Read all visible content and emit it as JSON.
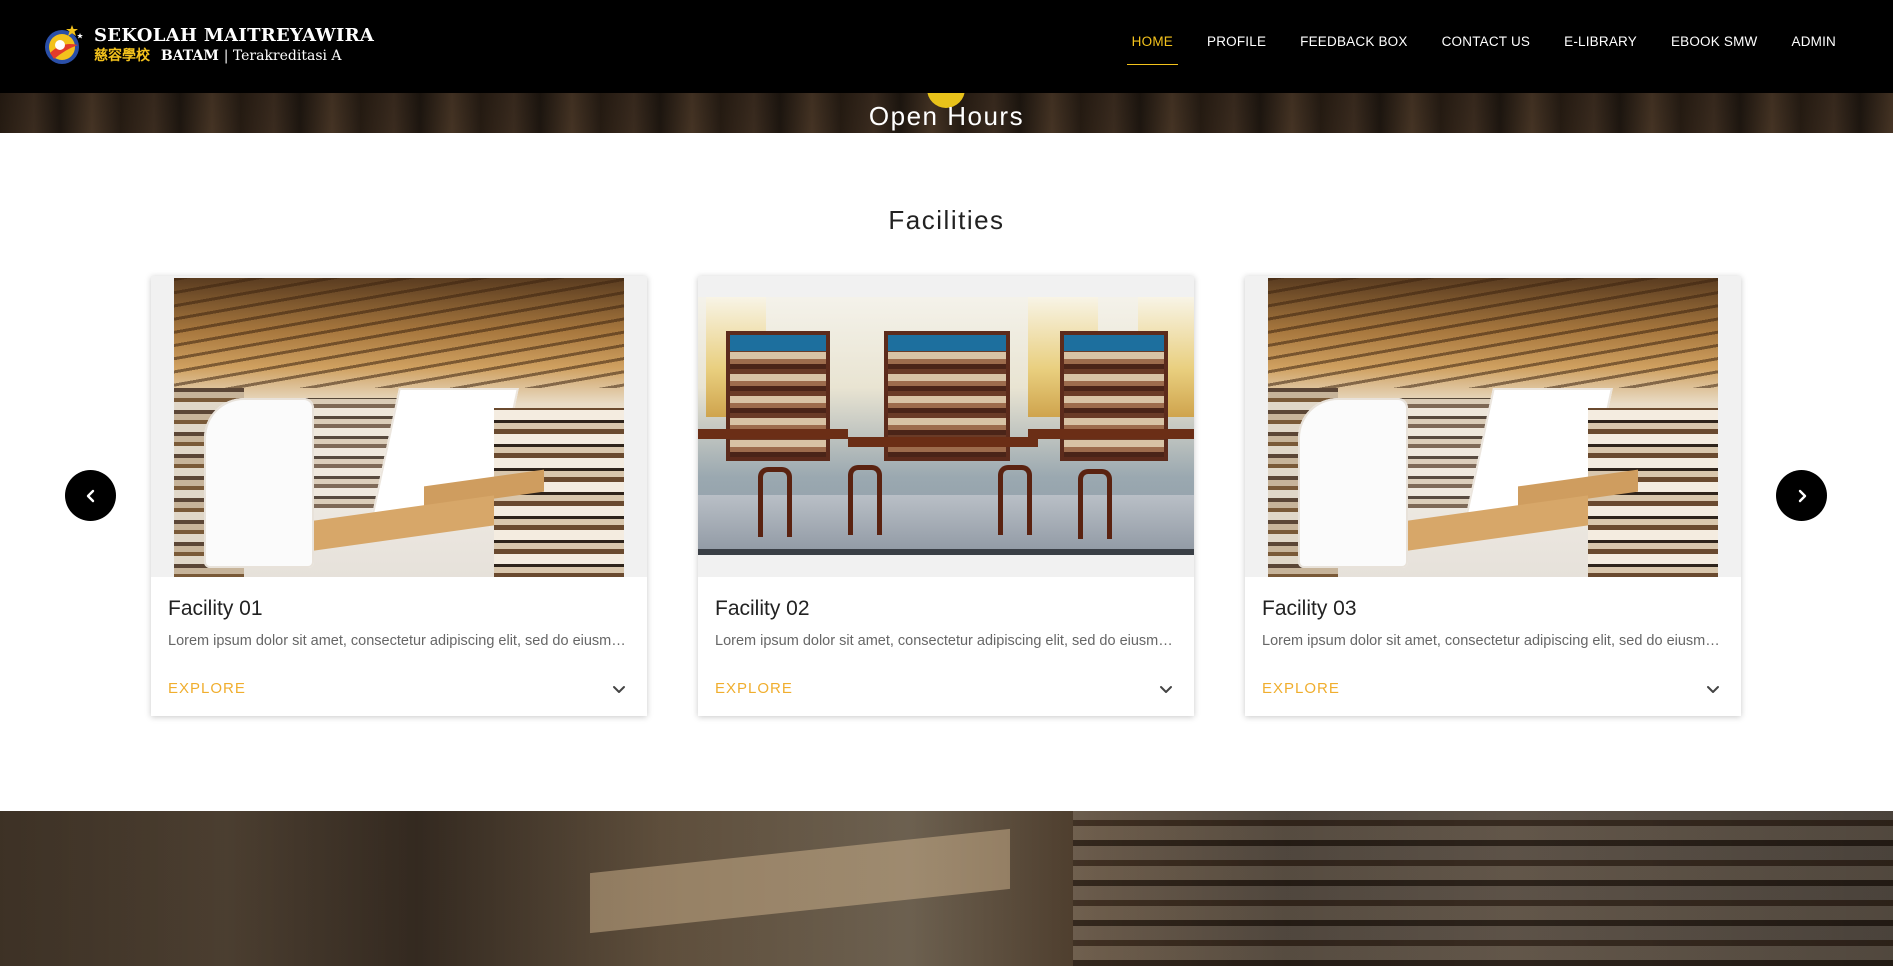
{
  "brand": {
    "name": "SEKOLAH MAITREYAWIRA",
    "chinese": "慈容學校",
    "city": "BATAM",
    "accreditation": "| Terakreditasi A"
  },
  "nav": {
    "items": [
      {
        "label": "HOME",
        "active": true
      },
      {
        "label": "PROFILE",
        "active": false
      },
      {
        "label": "FEEDBACK BOX",
        "active": false
      },
      {
        "label": "CONTACT US",
        "active": false
      },
      {
        "label": "E-LIBRARY",
        "active": false
      },
      {
        "label": "EBOOK SMW",
        "active": false
      },
      {
        "label": "ADMIN",
        "active": false
      }
    ],
    "active_color": "#f3c21c"
  },
  "facilities": {
    "title": "Facilities",
    "cards": [
      {
        "title": "Facility 01",
        "text": "Lorem ipsum dolor sit amet, consectetur adipiscing elit, sed do eiusmod tempor",
        "action": "EXPLORE"
      },
      {
        "title": "Facility 02",
        "text": "Lorem ipsum dolor sit amet, consectetur adipiscing elit, sed do eiusmod tempor",
        "action": "EXPLORE"
      },
      {
        "title": "Facility 03",
        "text": "Lorem ipsum dolor sit amet, consectetur adipiscing elit, sed do eiusmod tempor",
        "action": "EXPLORE"
      }
    ],
    "prev_icon": "chevron-left-icon",
    "next_icon": "chevron-right-icon",
    "accent_color": "#f0ae2e"
  },
  "hours": {
    "title": "Open Hours"
  }
}
